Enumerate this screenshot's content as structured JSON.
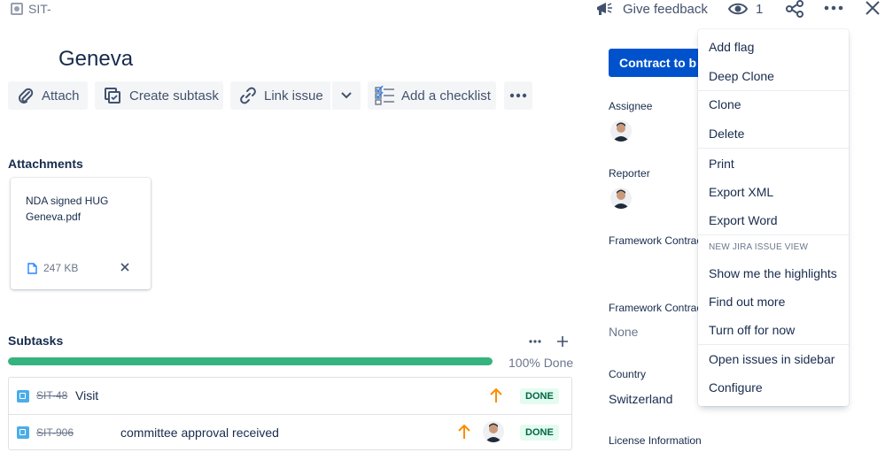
{
  "breadcrumb": {
    "issue_key": "SIT-"
  },
  "topbar": {
    "feedback_label": "Give feedback",
    "watchers_count": "1"
  },
  "issue": {
    "title": "Geneva"
  },
  "toolbar": {
    "attach_label": "Attach",
    "create_subtask_label": "Create subtask",
    "link_issue_label": "Link issue",
    "checklist_label": "Add a checklist"
  },
  "attachments": {
    "heading": "Attachments",
    "file_name": "NDA signed HUG Geneva.pdf",
    "file_size": "247 KB"
  },
  "subtasks": {
    "heading": "Subtasks",
    "progress_percent": 100,
    "progress_label": "100% Done",
    "rows": [
      {
        "key": "SIT-48",
        "title": "Visit",
        "status": "DONE"
      },
      {
        "key": "SIT-906",
        "title": "committee approval received",
        "status": "DONE"
      }
    ]
  },
  "sidebar": {
    "primary_button": "Contract to b",
    "assignee_label": "Assignee",
    "reporter_label": "Reporter",
    "framework_contract_1_label": "Framework Contrac",
    "framework_contract_2_label": "Framework Contrac",
    "framework_contract_2_value": "None",
    "country_label": "Country",
    "country_value": "Switzerland",
    "license_label": "License Information"
  },
  "menu": {
    "items_group1": [
      "Add flag",
      "Deep Clone"
    ],
    "items_group2": [
      "Clone",
      "Delete"
    ],
    "items_group3": [
      "Print",
      "Export XML",
      "Export Word"
    ],
    "section_heading": "NEW JIRA ISSUE VIEW",
    "items_group4": [
      "Show me the highlights",
      "Find out more",
      "Turn off for now"
    ],
    "items_group5": [
      "Open issues in sidebar",
      "Configure"
    ]
  },
  "colors": {
    "primary": "#0052cc",
    "success": "#36b37e",
    "done_lozenge_bg": "#e3fcef",
    "done_lozenge_text": "#006644",
    "priority_high": "#ff8b00"
  }
}
